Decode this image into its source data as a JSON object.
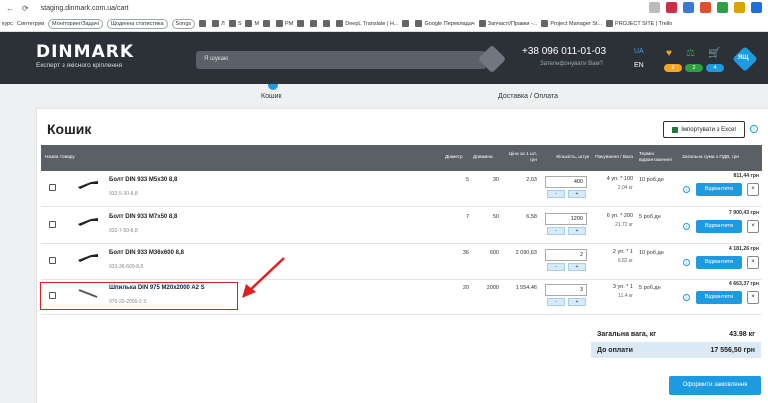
{
  "browser": {
    "url": "staging.dinmark.com.ua/cart",
    "bookmarks": [
      "курс",
      "Синтегрум",
      "Моніторинг/Задачі",
      "Щоденна статистика",
      "Songs",
      "",
      "Л",
      "S",
      "M",
      "",
      "PM",
      "",
      "",
      "",
      "DeepL Translate | Н...",
      "",
      "Google Перекладач",
      "Запчасті/Правки -...",
      "Project Manager St...",
      "PROJECT SITE | Trello"
    ]
  },
  "header": {
    "logo": "DINMARK",
    "tagline": "Експерт з якісного кріплення",
    "search_placeholder": "Я шукаю",
    "phone": "+38 096 011-01-03",
    "phone_sub": "Зателефонувати Вам?",
    "lang_ua": "UA",
    "lang_en": "EN",
    "badges": [
      "2",
      "2",
      "4"
    ],
    "chat": "ЯЩ"
  },
  "steps": {
    "step1": "Кошик",
    "step2": "Доставка / Оплата"
  },
  "cart": {
    "title": "Кошик",
    "import_label": "Імпортувати з Excel",
    "columns": [
      "Назва товару",
      "Діаметр",
      "Довжина",
      "Ціна за 1 шт, грн",
      "Кількість, штук",
      "Пакування / Вага",
      "Термін відвантаження",
      "Загальна сума з ПДВ, грн"
    ],
    "rows": [
      {
        "name": "Болт DIN 933 M5x30 8,8",
        "sku": "933-5-30-8,8",
        "diameter": "5",
        "length": "30",
        "price": "2,03",
        "qty": "400",
        "pack": "4 уп. * 100",
        "weight": "2,04 кг",
        "term": "10 роб.дн",
        "total": "811,44 грн"
      },
      {
        "name": "Болт DIN 933 M7x50 8,8",
        "sku": "933-7-50-8,8",
        "diameter": "7",
        "length": "50",
        "price": "6,58",
        "qty": "1200",
        "pack": "6 уп. * 200",
        "weight": "21.72 кг",
        "term": "5 роб.дн",
        "total": "7 900,43 грн"
      },
      {
        "name": "Болт DIN 933 M36x600 8,8",
        "sku": "933-36-600-8,8",
        "diameter": "36",
        "length": "600",
        "price": "2 090,63",
        "qty": "2",
        "pack": "2 уп. * 1",
        "weight": "6.82 кг",
        "term": "10 роб.дн",
        "total": "4 181,26 грн"
      },
      {
        "name": "Шпилька DIN 975 M20x2000 A2 S",
        "sku": "975-20-2000-2 S",
        "diameter": "20",
        "length": "2000",
        "price": "1 554,46",
        "qty": "3",
        "pack": "3 уп. * 1",
        "weight": "11.4 кг",
        "term": "5 роб.дн",
        "total": "4 663,37 грн"
      }
    ],
    "ship_label": "Відвантити",
    "minus": "-",
    "plus": "+",
    "close": "×",
    "info": "i",
    "weight_label": "Загальна вага, кг",
    "weight_value": "43.98 кг",
    "pay_label": "До оплати",
    "pay_value": "17 556,50 грн",
    "order_button": "Оформити замовлення"
  },
  "colors": {
    "accent": "#1e9be0",
    "header_bg": "#2b3137",
    "annotation": "#e02020"
  }
}
